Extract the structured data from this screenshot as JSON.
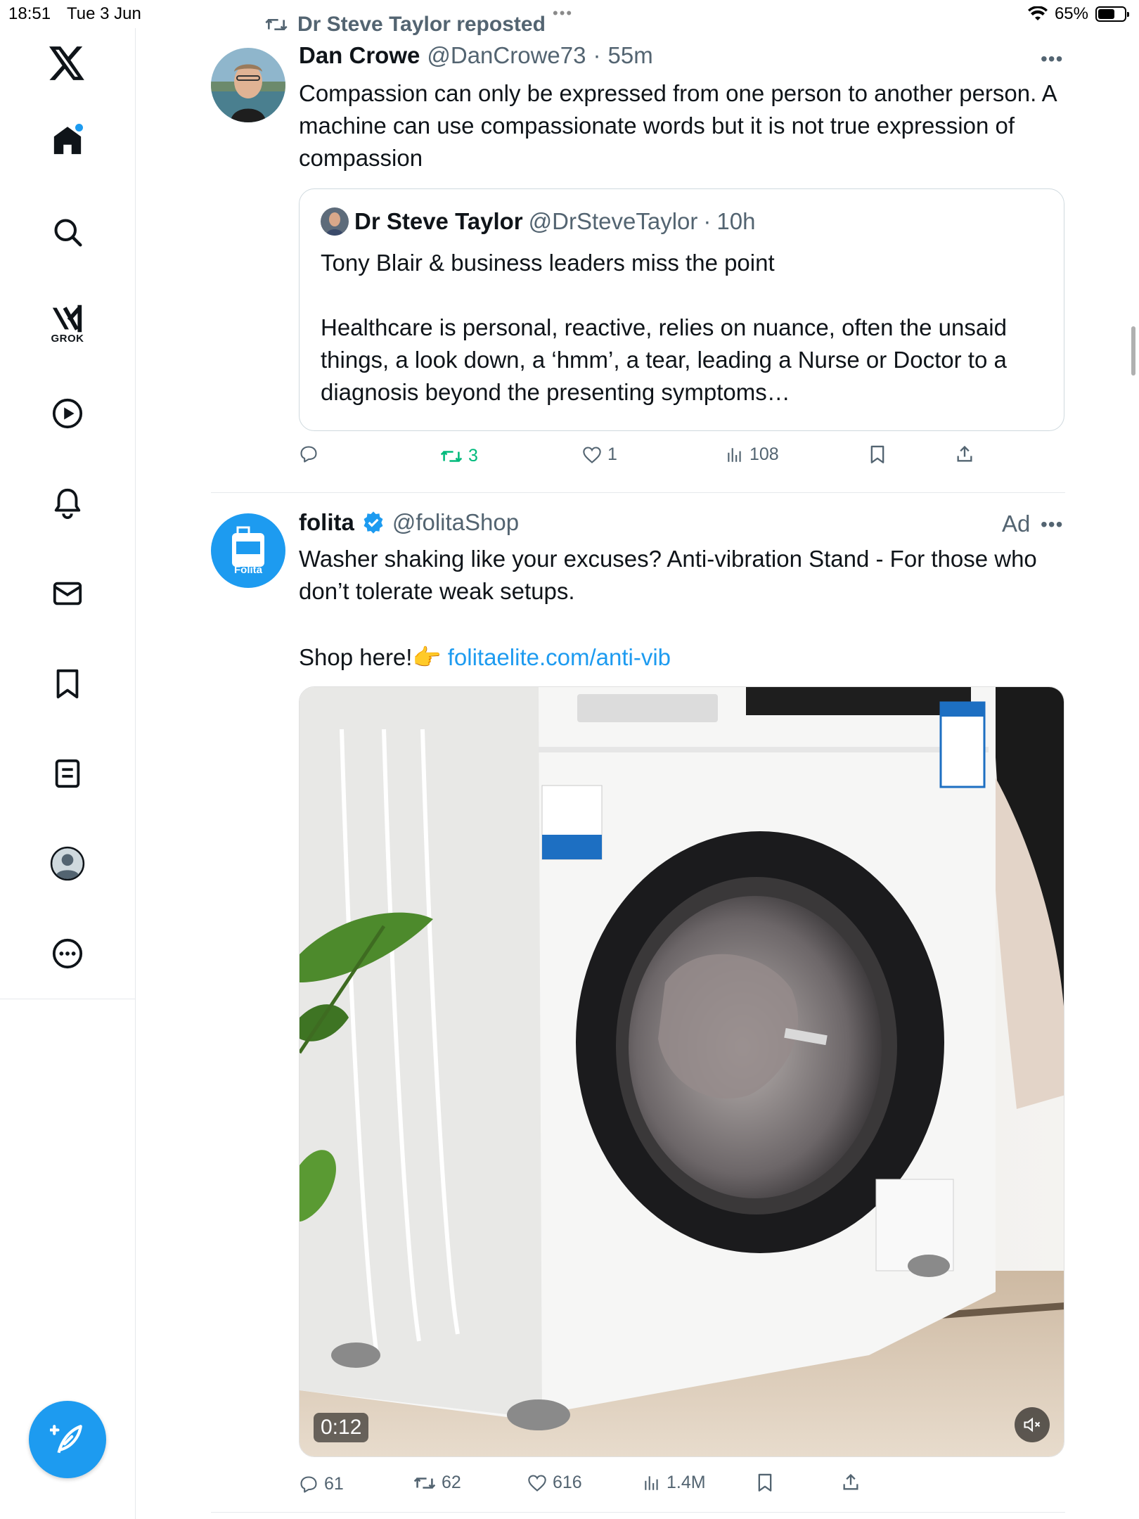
{
  "status_bar": {
    "time": "18:51",
    "date": "Tue 3 Jun",
    "battery": "65%"
  },
  "sidebar": {
    "items": [
      {
        "name": "logo",
        "icon": "x-logo-icon"
      },
      {
        "name": "home",
        "icon": "home-icon"
      },
      {
        "name": "explore",
        "icon": "search-icon"
      },
      {
        "name": "grok",
        "icon": "grok-icon",
        "label": "GROK"
      },
      {
        "name": "video",
        "icon": "play-icon"
      },
      {
        "name": "notifications",
        "icon": "bell-icon"
      },
      {
        "name": "messages",
        "icon": "mail-icon"
      },
      {
        "name": "bookmarks",
        "icon": "bookmark-icon"
      },
      {
        "name": "lists",
        "icon": "list-icon"
      },
      {
        "name": "profile",
        "icon": "avatar-icon"
      },
      {
        "name": "more",
        "icon": "more-icon"
      }
    ],
    "compose_icon": "compose-icon"
  },
  "tweet1": {
    "repost_label": "Dr Steve Taylor reposted",
    "author_name": "Dan Crowe",
    "author_handle": "@DanCrowe73",
    "time": "55m",
    "text": "Compassion can only be expressed from one person to another person. A machine can use compassionate words but it is not true expression of compassion",
    "quote": {
      "author_name": "Dr Steve Taylor",
      "author_handle": "@DrSteveTaylor",
      "time": "10h",
      "line1": "Tony Blair & business leaders miss the point",
      "line2": "Healthcare is personal, reactive, relies on nuance, often the unsaid things, a look down, a ‘hmm’, a tear, leading a Nurse or Doctor to a diagnosis beyond the presenting symptoms…"
    },
    "stats": {
      "reposts": "3",
      "likes": "1",
      "views": "108"
    }
  },
  "tweet2": {
    "author_name": "folita",
    "author_handle": "@folitaShop",
    "ad_label": "Ad",
    "avatar_label": "Folita",
    "text": "Washer shaking like your excuses? Anti-vibration Stand - For those who don’t tolerate weak setups.",
    "shop_prefix": "Shop here!👉 ",
    "link": "folitaelite.com/anti-vib",
    "video_duration": "0:12",
    "stats": {
      "replies": "61",
      "reposts": "62",
      "likes": "616",
      "views": "1.4M"
    }
  },
  "colors": {
    "accent": "#1d9bf0",
    "repost_active": "#00ba7c",
    "secondary_text": "#536471"
  }
}
